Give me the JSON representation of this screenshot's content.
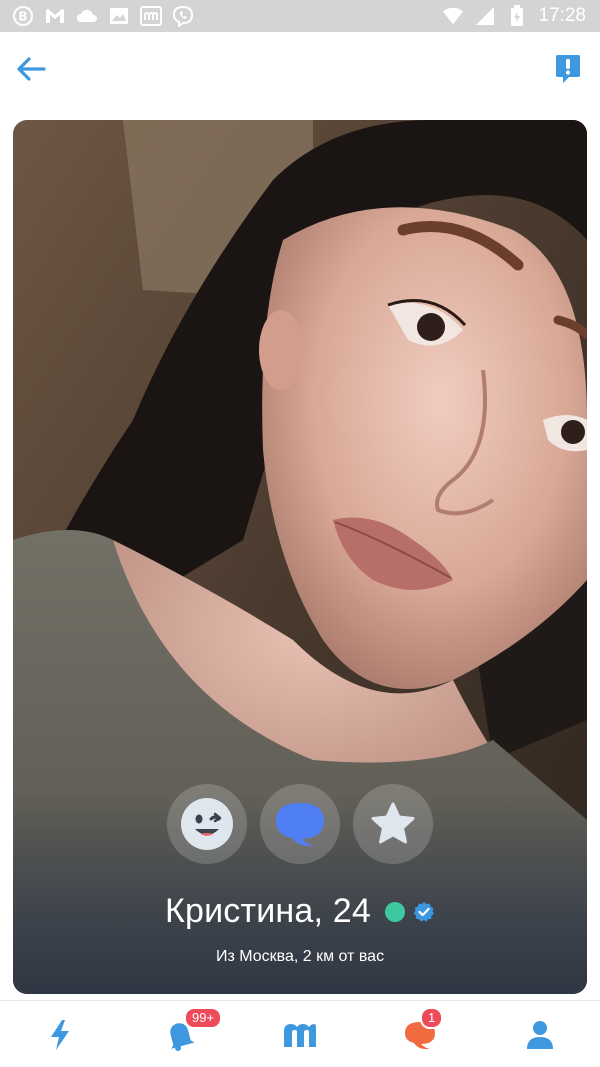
{
  "status_bar": {
    "time": "17:28",
    "left_icons": [
      "vk-icon",
      "gmail-icon",
      "cloud-icon",
      "image-icon",
      "mamba-icon",
      "viber-icon"
    ],
    "right_icons": [
      "wifi-icon",
      "signal-icon",
      "battery-icon"
    ]
  },
  "header": {
    "back_icon": "arrow-left-icon",
    "report_icon": "report-icon"
  },
  "profile": {
    "name_age": "Кристина, 24",
    "location": "Из Москва, 2 км от вас",
    "online": true,
    "verified": true
  },
  "actions": [
    {
      "name": "wink",
      "icon": "wink-emoji-icon"
    },
    {
      "name": "message",
      "icon": "chat-bubble-icon"
    },
    {
      "name": "favorite",
      "icon": "star-icon"
    }
  ],
  "bottom_nav": {
    "items": [
      {
        "name": "encounters",
        "icon": "lightning-icon",
        "badge": ""
      },
      {
        "name": "notifications",
        "icon": "bell-icon",
        "badge": "99+"
      },
      {
        "name": "mamba",
        "icon": "mamba-logo-icon",
        "badge": ""
      },
      {
        "name": "messages",
        "icon": "chat-icon",
        "badge": "1"
      },
      {
        "name": "profile",
        "icon": "person-icon",
        "badge": ""
      }
    ]
  },
  "colors": {
    "accent": "#3d98e0",
    "online": "#3dc9a0",
    "badge": "#ef4a5a",
    "status_bar": "#d4d4d4"
  }
}
